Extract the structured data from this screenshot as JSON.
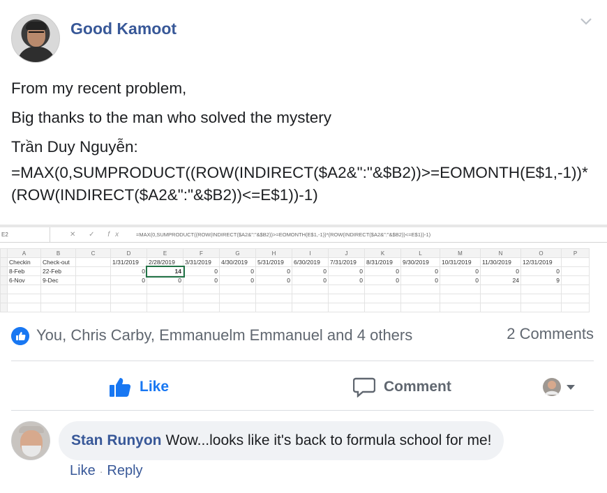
{
  "post": {
    "author": "Good Kamoot",
    "lines": [
      "From my recent problem,",
      "Big thanks to the man who solved the mystery",
      "Trần Duy Nguyễn:"
    ],
    "formula": "=MAX(0,SUMPRODUCT((ROW(INDIRECT($A2&\":\"&$B2))>=EOMONTH(E$1,-1))*(ROW(INDIRECT($A2&\":\"&$B2))<=E$1))-1)"
  },
  "spreadsheet": {
    "name_box": "E2",
    "formula_bar": "=MAX(0,SUMPRODUCT((ROW(INDIRECT($A2&\":\"&$B2))>=EOMONTH(E$1,-1))*(ROW(INDIRECT($A2&\":\"&$B2))<=E$1))-1)",
    "columns": [
      "A",
      "B",
      "C",
      "D",
      "E",
      "F",
      "G",
      "H",
      "I",
      "J",
      "K",
      "L",
      "M",
      "N",
      "O",
      "P"
    ],
    "rows": [
      [
        "Checkin",
        "Check-out",
        "",
        "1/31/2019",
        "2/28/2019",
        "3/31/2019",
        "4/30/2019",
        "5/31/2019",
        "6/30/2019",
        "7/31/2019",
        "8/31/2019",
        "9/30/2019",
        "10/31/2019",
        "11/30/2019",
        "12/31/2019",
        ""
      ],
      [
        "8-Feb",
        "22-Feb",
        "",
        "0",
        "14",
        "0",
        "0",
        "0",
        "0",
        "0",
        "0",
        "0",
        "0",
        "0",
        "0",
        ""
      ],
      [
        "6-Nov",
        "9-Dec",
        "",
        "0",
        "0",
        "0",
        "0",
        "0",
        "0",
        "0",
        "0",
        "0",
        "0",
        "24",
        "9",
        ""
      ],
      [
        "",
        "",
        "",
        "",
        "",
        "",
        "",
        "",
        "",
        "",
        "",
        "",
        "",
        "",
        "",
        ""
      ],
      [
        "",
        "",
        "",
        "",
        "",
        "",
        "",
        "",
        "",
        "",
        "",
        "",
        "",
        "",
        "",
        ""
      ],
      [
        "",
        "",
        "",
        "",
        "",
        "",
        "",
        "",
        "",
        "",
        "",
        "",
        "",
        "",
        "",
        ""
      ]
    ]
  },
  "reactions": {
    "text": "You, Chris Carby, Emmanuelm Emmanuel and 4 others",
    "comments_count": "2 Comments"
  },
  "actions": {
    "like": "Like",
    "comment": "Comment"
  },
  "comment": {
    "author": "Stan Runyon",
    "text": "Wow...looks like it's back to formula school for me!",
    "like": "Like",
    "reply": "Reply"
  },
  "colors": {
    "link": "#385898",
    "like_blue": "#1877f2",
    "muted": "#606770"
  }
}
